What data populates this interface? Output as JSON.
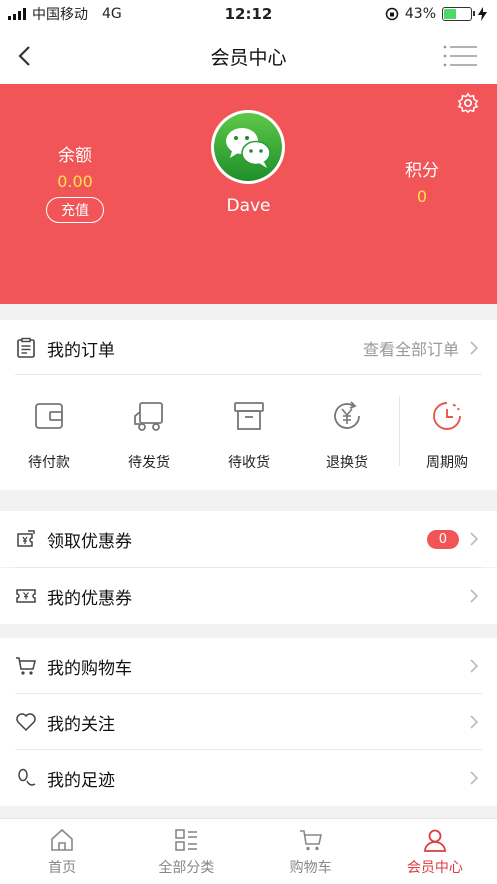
{
  "status": {
    "carrier": "中国移动",
    "network": "4G",
    "time": "12:12",
    "battery": "43%",
    "battery_level": 0.43
  },
  "nav": {
    "title": "会员中心"
  },
  "profile": {
    "balance_label": "余额",
    "balance_value": "0.00",
    "recharge_label": "充值",
    "username": "Dave",
    "points_label": "积分",
    "points_value": "0"
  },
  "orders": {
    "title": "我的订单",
    "view_all": "查看全部订单",
    "items": [
      {
        "label": "待付款",
        "icon": "wallet-icon"
      },
      {
        "label": "待发货",
        "icon": "truck-icon"
      },
      {
        "label": "待收货",
        "icon": "box-icon"
      },
      {
        "label": "退换货",
        "icon": "yen-refresh-icon"
      },
      {
        "label": "周期购",
        "icon": "clock-icon"
      }
    ]
  },
  "coupons": {
    "claim_label": "领取优惠券",
    "claim_count": "0",
    "mine_label": "我的优惠券"
  },
  "menu": {
    "cart_label": "我的购物车",
    "follow_label": "我的关注",
    "history_label": "我的足迹"
  },
  "tabs": [
    {
      "label": "首页",
      "icon": "home-icon"
    },
    {
      "label": "全部分类",
      "icon": "category-icon"
    },
    {
      "label": "购物车",
      "icon": "cart-icon"
    },
    {
      "label": "会员中心",
      "icon": "user-icon",
      "active": true
    }
  ],
  "colors": {
    "accent": "#f25557",
    "balance": "#ffe14d",
    "active_tab": "#e23a3d"
  }
}
